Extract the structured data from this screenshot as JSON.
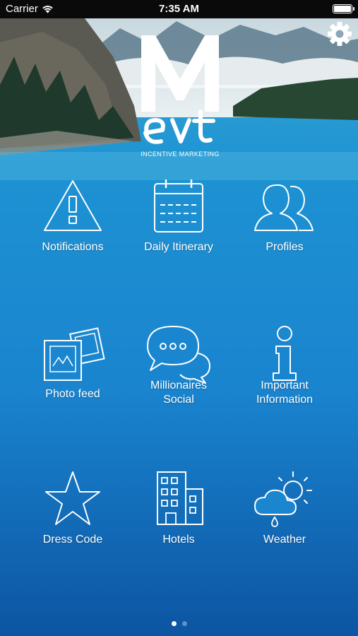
{
  "status_bar": {
    "carrier": "Carrier",
    "time": "7:35 AM"
  },
  "logo": {
    "letter": "M",
    "brand": "evt",
    "tagline": "INCENTIVE MARKETING"
  },
  "settings": {
    "icon": "gear-icon"
  },
  "tiles": [
    {
      "label": "Notifications",
      "icon": "warning-icon"
    },
    {
      "label": "Daily Itinerary",
      "icon": "calendar-icon"
    },
    {
      "label": "Profiles",
      "icon": "people-icon"
    },
    {
      "label": "Photo feed",
      "icon": "photos-icon"
    },
    {
      "label": "Millionaires\nSocial",
      "icon": "chat-bubbles-icon"
    },
    {
      "label": "Important\nInformation",
      "icon": "info-icon"
    },
    {
      "label": "Dress Code",
      "icon": "star-icon"
    },
    {
      "label": "Hotels",
      "icon": "building-icon"
    },
    {
      "label": "Weather",
      "icon": "weather-icon"
    }
  ],
  "pager": {
    "pages": 2,
    "active": 0
  }
}
